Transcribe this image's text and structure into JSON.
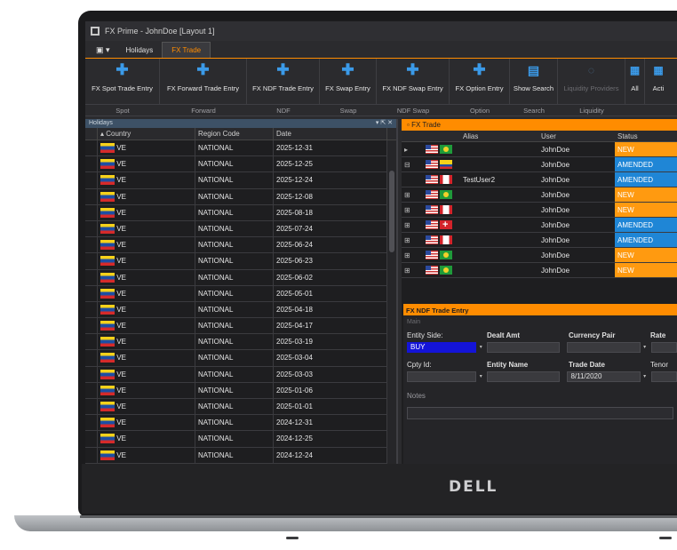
{
  "window": {
    "title": "FX Prime - JohnDoe [Layout 1]"
  },
  "tabs": [
    {
      "label": "Holidays",
      "active": false
    },
    {
      "label": "FX Trade",
      "active": true
    }
  ],
  "ribbon": {
    "buttons": [
      {
        "label": "FX Spot Trade Entry",
        "icon": "plus-icon"
      },
      {
        "label": "FX Forward Trade Entry",
        "icon": "plus-icon"
      },
      {
        "label": "FX NDF Trade Entry",
        "icon": "plus-icon"
      },
      {
        "label": "FX Swap Entry",
        "icon": "plus-icon"
      },
      {
        "label": "FX NDF Swap Entry",
        "icon": "plus-icon"
      },
      {
        "label": "FX Option Entry",
        "icon": "plus-icon"
      },
      {
        "label": "Show Search",
        "icon": "search-document-icon"
      },
      {
        "label": "Liquidity Providers",
        "icon": "liquidity-icon"
      },
      {
        "label": "All",
        "icon": "chart-icon"
      },
      {
        "label": "Acti",
        "icon": "chart-icon"
      }
    ],
    "groups": [
      "Spot",
      "Forward",
      "NDF",
      "Swap",
      "NDF Swap",
      "Option",
      "Search",
      "Liquidity"
    ]
  },
  "holidays": {
    "title": "Holidays",
    "columns": [
      "Country",
      "Region Code",
      "Date"
    ],
    "rows": [
      [
        "VE",
        "NATIONAL",
        "2025-12-31"
      ],
      [
        "VE",
        "NATIONAL",
        "2025-12-25"
      ],
      [
        "VE",
        "NATIONAL",
        "2025-12-24"
      ],
      [
        "VE",
        "NATIONAL",
        "2025-12-08"
      ],
      [
        "VE",
        "NATIONAL",
        "2025-08-18"
      ],
      [
        "VE",
        "NATIONAL",
        "2025-07-24"
      ],
      [
        "VE",
        "NATIONAL",
        "2025-06-24"
      ],
      [
        "VE",
        "NATIONAL",
        "2025-06-23"
      ],
      [
        "VE",
        "NATIONAL",
        "2025-06-02"
      ],
      [
        "VE",
        "NATIONAL",
        "2025-05-01"
      ],
      [
        "VE",
        "NATIONAL",
        "2025-04-18"
      ],
      [
        "VE",
        "NATIONAL",
        "2025-04-17"
      ],
      [
        "VE",
        "NATIONAL",
        "2025-03-19"
      ],
      [
        "VE",
        "NATIONAL",
        "2025-03-04"
      ],
      [
        "VE",
        "NATIONAL",
        "2025-03-03"
      ],
      [
        "VE",
        "NATIONAL",
        "2025-01-06"
      ],
      [
        "VE",
        "NATIONAL",
        "2025-01-01"
      ],
      [
        "VE",
        "NATIONAL",
        "2024-12-31"
      ],
      [
        "VE",
        "NATIONAL",
        "2024-12-25"
      ],
      [
        "VE",
        "NATIONAL",
        "2024-12-24"
      ]
    ]
  },
  "fx_trade": {
    "title": "FX Trade",
    "columns": [
      "Alias",
      "User",
      "Status"
    ],
    "rows": [
      {
        "expander": "▸",
        "flags": [
          "us",
          "br"
        ],
        "alias": "",
        "user": "JohnDoe",
        "status": "NEW"
      },
      {
        "expander": "⊟",
        "flags": [
          "us",
          "co"
        ],
        "alias": "",
        "user": "JohnDoe",
        "status": "AMENDED"
      },
      {
        "expander": "",
        "flags": [
          "us",
          "ca"
        ],
        "alias": "TestUser2",
        "user": "JohnDoe",
        "status": "AMENDED"
      },
      {
        "expander": "⊞",
        "flags": [
          "us",
          "br"
        ],
        "alias": "",
        "user": "JohnDoe",
        "status": "NEW"
      },
      {
        "expander": "⊞",
        "flags": [
          "us",
          "ca"
        ],
        "alias": "",
        "user": "JohnDoe",
        "status": "NEW"
      },
      {
        "expander": "⊞",
        "flags": [
          "us",
          "ch"
        ],
        "alias": "",
        "user": "JohnDoe",
        "status": "AMENDED"
      },
      {
        "expander": "⊞",
        "flags": [
          "us",
          "ca"
        ],
        "alias": "",
        "user": "JohnDoe",
        "status": "AMENDED"
      },
      {
        "expander": "⊞",
        "flags": [
          "us",
          "br"
        ],
        "alias": "",
        "user": "JohnDoe",
        "status": "NEW"
      },
      {
        "expander": "⊞",
        "flags": [
          "us",
          "br"
        ],
        "alias": "",
        "user": "JohnDoe",
        "status": "NEW"
      }
    ]
  },
  "ndf_entry": {
    "title": "FX NDF Trade Entry",
    "section": "Main",
    "labels_row1": [
      "Entity Side:",
      "Dealt Amt",
      "Currency Pair",
      "Rate"
    ],
    "entity_side": "BUY",
    "labels_row2": [
      "Cpty Id:",
      "Entity Name",
      "Trade Date",
      "Tenor"
    ],
    "trade_date": "8/11/2020",
    "notes_label": "Notes"
  },
  "brand": {
    "logo": "DELL"
  },
  "colors": {
    "accent": "#ff8c00",
    "new": "#ff9a10",
    "amended": "#1f86d6",
    "buy": "#1414d8"
  }
}
